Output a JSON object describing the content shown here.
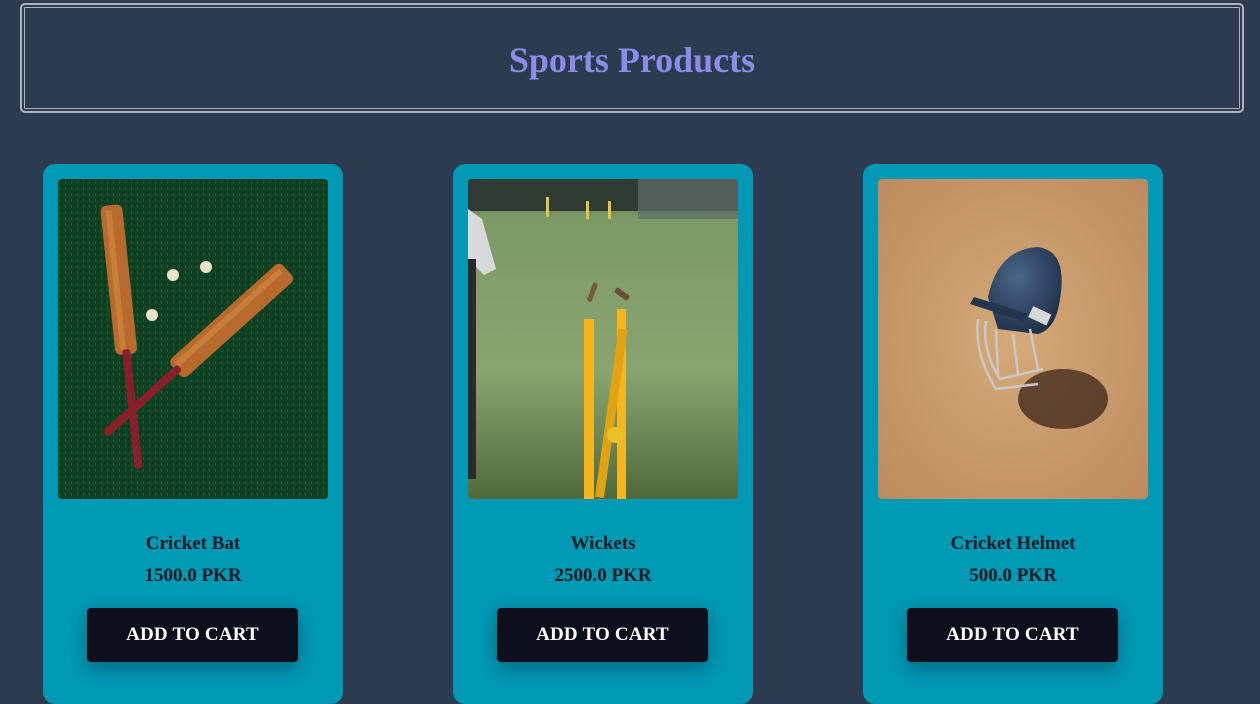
{
  "header": {
    "title": "Sports Products"
  },
  "products": [
    {
      "name": "Cricket Bat",
      "price": "1500.0 PKR",
      "button_label": "ADD TO CART",
      "image": "cricket-bat-photo"
    },
    {
      "name": "Wickets",
      "price": "2500.0 PKR",
      "button_label": "ADD TO CART",
      "image": "wickets-photo"
    },
    {
      "name": "Cricket Helmet",
      "price": "500.0 PKR",
      "button_label": "ADD TO CART",
      "image": "cricket-helmet-photo"
    }
  ],
  "colors": {
    "page_background": "#2d3b50",
    "title": "#8a8ce8",
    "card": "#0099b5",
    "button": "#0d0f1c"
  }
}
